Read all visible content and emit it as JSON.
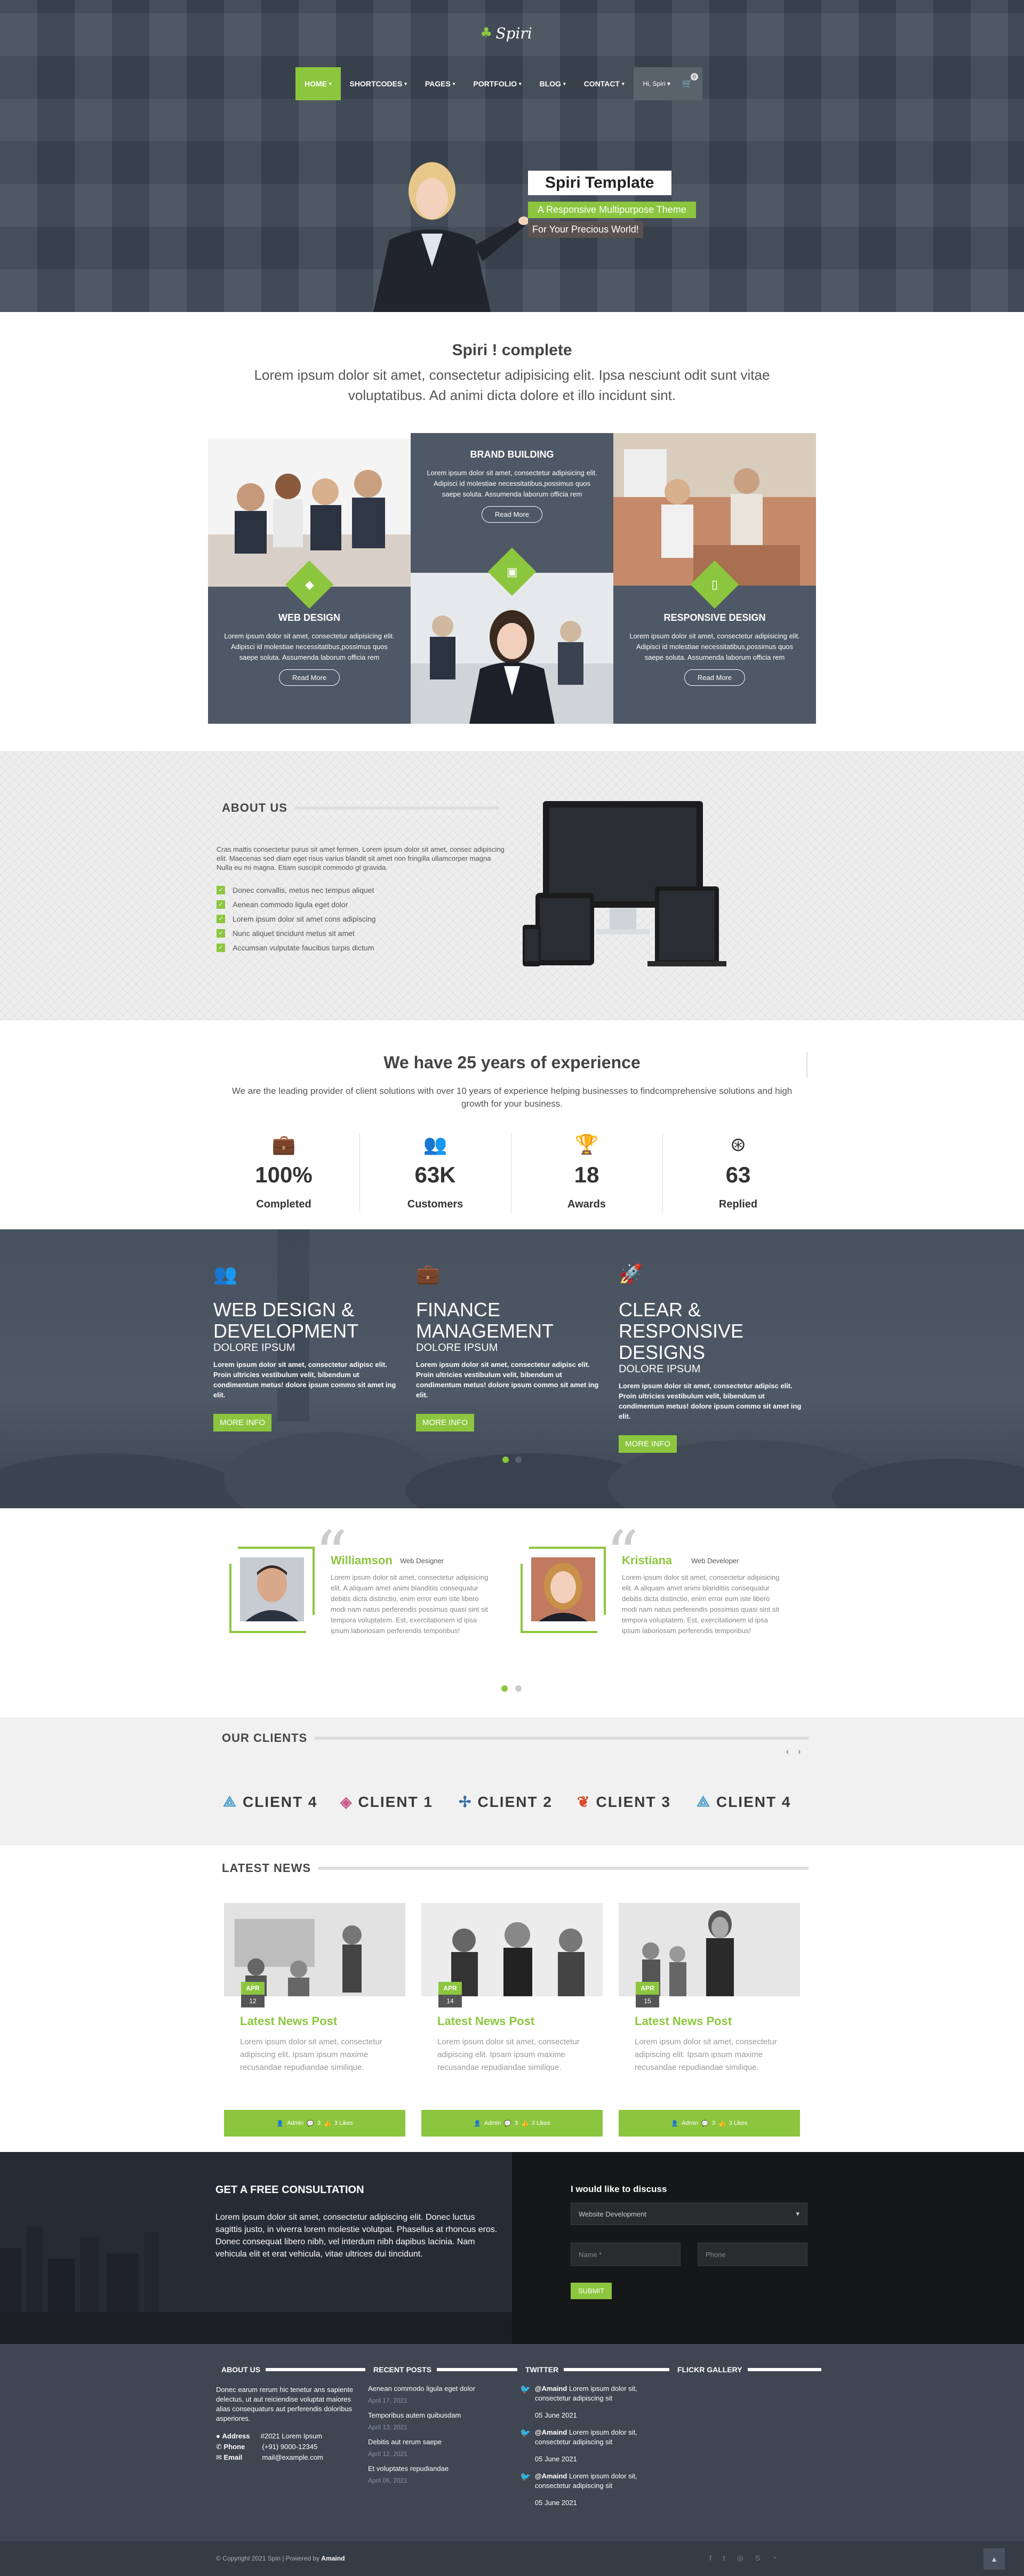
{
  "colors": {
    "accent": "#8cc63f",
    "dark": "#4f5866",
    "header_bg": "#3f4855"
  },
  "header": {
    "logo": "Spiri",
    "nav": [
      {
        "label": "Home",
        "active": true
      },
      {
        "label": "Shortcodes"
      },
      {
        "label": "Pages"
      },
      {
        "label": "Portfolio"
      },
      {
        "label": "Blog"
      },
      {
        "label": "Contact"
      }
    ],
    "user_greeting": "Hi, Spiri",
    "cart_count": "0"
  },
  "hero": {
    "title": "Spiri Template",
    "subtitle": "A Responsive Multipurpose Theme",
    "tagline": "For Your Precious World!"
  },
  "intro": {
    "title": "Spiri ! complete",
    "text": "Lorem ipsum dolor sit amet, consectetur adipisicing elit. Ipsa nesciunt odit sunt vitae voluptatibus. Ad animi dicta dolore et illo incidunt sint."
  },
  "services": [
    {
      "title": "Web Design",
      "text": "Lorem ipsum dolor sit amet, consectetur adipisicing elit. Adipisci id molestiae necessitatibus,possimus quos saepe soluta. Assumenda laborum officia rem",
      "button": "Read More",
      "icon": "diamond-icon"
    },
    {
      "title": "Brand Building",
      "text": "Lorem ipsum dolor sit amet, consectetur adipisicing elit. Adipisci id molestiae necessitatibus,possimus quos saepe soluta. Assumenda laborum officia rem",
      "button": "Read More",
      "icon": "briefcase-icon"
    },
    {
      "title": "Responsive Design",
      "text": "Lorem ipsum dolor sit amet, consectetur adipisicing elit. Adipisci id molestiae necessitatibus,possimus quos saepe soluta. Assumenda laborum officia rem",
      "button": "Read More",
      "icon": "mobile-icon"
    }
  ],
  "about": {
    "title": "About Us",
    "text": "Cras mattis consectetur purus sit amet fermen. Lorem ipsum dolor sit amet, consec adipiscing elit. Maecenas sed diam eget risus varius blandit sit amet non fringilla ullamcorper magna Nulla eu mi magna. Etiam suscipit commodo gt gravida.",
    "items": [
      "Donec convallis, metus nec tempus aliquet",
      "Aenean commodo ligula eget dolor",
      "Lorem ipsum dolor sit amet cons adipiscing",
      "Nunc aliquet tincidunt metus sit amet",
      "Accumsan vulputate faucibus turpis dictum"
    ]
  },
  "experience": {
    "title": "We have 25 years of experience",
    "text": "We are the leading provider of client solutions with over 10 years of experience helping businesses to findcomprehensive solutions and high growth for your business.",
    "stats": [
      {
        "value": "100%",
        "label": "Completed",
        "icon": "briefcase-icon"
      },
      {
        "value": "63K",
        "label": "Customers",
        "icon": "users-icon"
      },
      {
        "value": "18",
        "label": "Awards",
        "icon": "trophy-icon"
      },
      {
        "value": "63",
        "label": "Replied",
        "icon": "lifebuoy-icon"
      }
    ]
  },
  "features": [
    {
      "title": "Web Design & Development",
      "sub": "Dolore ipsum",
      "text": "Lorem ipsum dolor sit amet, consectetur adipisc elit. Proin ultricies vestibulum velit, bibendum ut condimentum metus! dolore ipsum commo sit amet ing elit.",
      "button": "More Info",
      "icon": "users-icon"
    },
    {
      "title": "Finance Management",
      "sub": "Dolore ipsum",
      "text": "Lorem ipsum dolor sit amet, consectetur adipisc elit. Proin ultricies vestibulum velit, bibendum ut condimentum metus! dolore ipsum commo sit amet ing elit.",
      "button": "More Info",
      "icon": "briefcase-icon"
    },
    {
      "title": "Clear & Responsive Designs",
      "sub": "Dolore ipsum",
      "text": "Lorem ipsum dolor sit amet, consectetur adipisc elit. Proin ultricies vestibulum velit, bibendum ut condimentum metus! dolore ipsum commo sit amet ing elit.",
      "button": "More Info",
      "icon": "rocket-icon"
    }
  ],
  "testimonials": [
    {
      "name": "Williamson",
      "role": "Web Designer",
      "text": "Lorem ipsum dolor sit amet, consectetur adipisicing elit. A aliquam amet animi blanditiis consequatur debitis dicta distinctio, enim error eum iste libero modi nam natus perferendis possimus quasi sint sit tempora voluptatem. Est, exercitationem id ipsa ipsum laboriosam perferendis temporibus!"
    },
    {
      "name": "Kristiana",
      "role": "Web Developer",
      "text": "Lorem ipsum dolor sit amet, consectetur adipisicing elit. A aliquam amet animi blanditiis consequatur debitis dicta distinctio, enim error eum iste libero modi nam natus perferendis possimus quasi sint sit tempora voluptatem. Est, exercitationem id ipsa ipsum laboriosam perferendis temporibus!"
    }
  ],
  "clients": {
    "title": "Our Clients",
    "items": [
      "CLIENT 4",
      "CLIENT 1",
      "CLIENT 2",
      "CLIENT 3",
      "CLIENT 4"
    ]
  },
  "news": {
    "title": "Latest News",
    "posts": [
      {
        "month": "APR",
        "day": "12",
        "title": "Latest News Post",
        "text": "Lorem ipsum dolor sit amet, consectetur adipiscing elit. Ipsam ipsum maxime recusandae repudiandae similique.",
        "meta": "Admin",
        "comments": "3",
        "likes": "3 Likes"
      },
      {
        "month": "APR",
        "day": "14",
        "title": "Latest News Post",
        "text": "Lorem ipsum dolor sit amet, consectetur adipiscing elit. Ipsam ipsum maxime recusandae repudiandae similique.",
        "meta": "Admin",
        "comments": "3",
        "likes": "3 Likes"
      },
      {
        "month": "APR",
        "day": "15",
        "title": "Latest News Post",
        "text": "Lorem ipsum dolor sit amet, consectetur adipiscing elit. Ipsam ipsum maxime recusandae repudiandae similique.",
        "meta": "Admin",
        "comments": "3",
        "likes": "3 Likes"
      }
    ]
  },
  "consult": {
    "title": "Get a free consultation",
    "text": "Lorem ipsum dolor sit amet, consectetur adipiscing elit. Donec luctus sagittis justo, in viverra lorem molestie volutpat. Phasellus at rhoncus eros. Donec consequat libero nibh, vel interdum nibh dapibus lacinia. Nam vehicula elit et erat vehicula, vitae ultrices dui tincidunt.",
    "form_title": "I would like to discuss",
    "select": "Website Development",
    "name_ph": "Name *",
    "phone_ph": "Phone",
    "submit": "Submit"
  },
  "footer": {
    "about": {
      "title": "About Us",
      "text": "Donec earum rerum hic tenetur ans sapiente delectus, ut aut reiciendise voluptat maiores alias consequaturs aut perferendis doloribus asperiores.",
      "address_label": "Address",
      "address": "#2021 Lorem Ipsum",
      "phone_label": "Phone",
      "phone": "(+91) 9000-12345",
      "email_label": "Email",
      "email": "mail@example.com"
    },
    "recent": {
      "title": "Recent Posts",
      "items": [
        {
          "t": "Aenean commodo ligula eget dolor",
          "d": "April 17, 2021"
        },
        {
          "t": "Temporibus autem quibusdam",
          "d": "April 13, 2021"
        },
        {
          "t": "Debitis aut rerum saepe",
          "d": "April 12, 2021"
        },
        {
          "t": "Et voluptates repudiandae",
          "d": "April 06, 2021"
        }
      ]
    },
    "twitter": {
      "title": "Twitter",
      "items": [
        {
          "h": "@Amaind",
          "t": "Lorem ipsum dolor sit, consectetur adipiscing sit",
          "d": "05 June 2021"
        },
        {
          "h": "@Amaind",
          "t": "Lorem ipsum dolor sit, consectetur adipiscing sit",
          "d": "05 June 2021"
        },
        {
          "h": "@Amaind",
          "t": "Lorem ipsum dolor sit, consectetur adipiscing sit",
          "d": "05 June 2021"
        }
      ]
    },
    "flickr": {
      "title": "Flickr Gallery"
    },
    "copyright": "© Copyright 2021 Spiri | Powered by",
    "powered": "Amaind"
  }
}
